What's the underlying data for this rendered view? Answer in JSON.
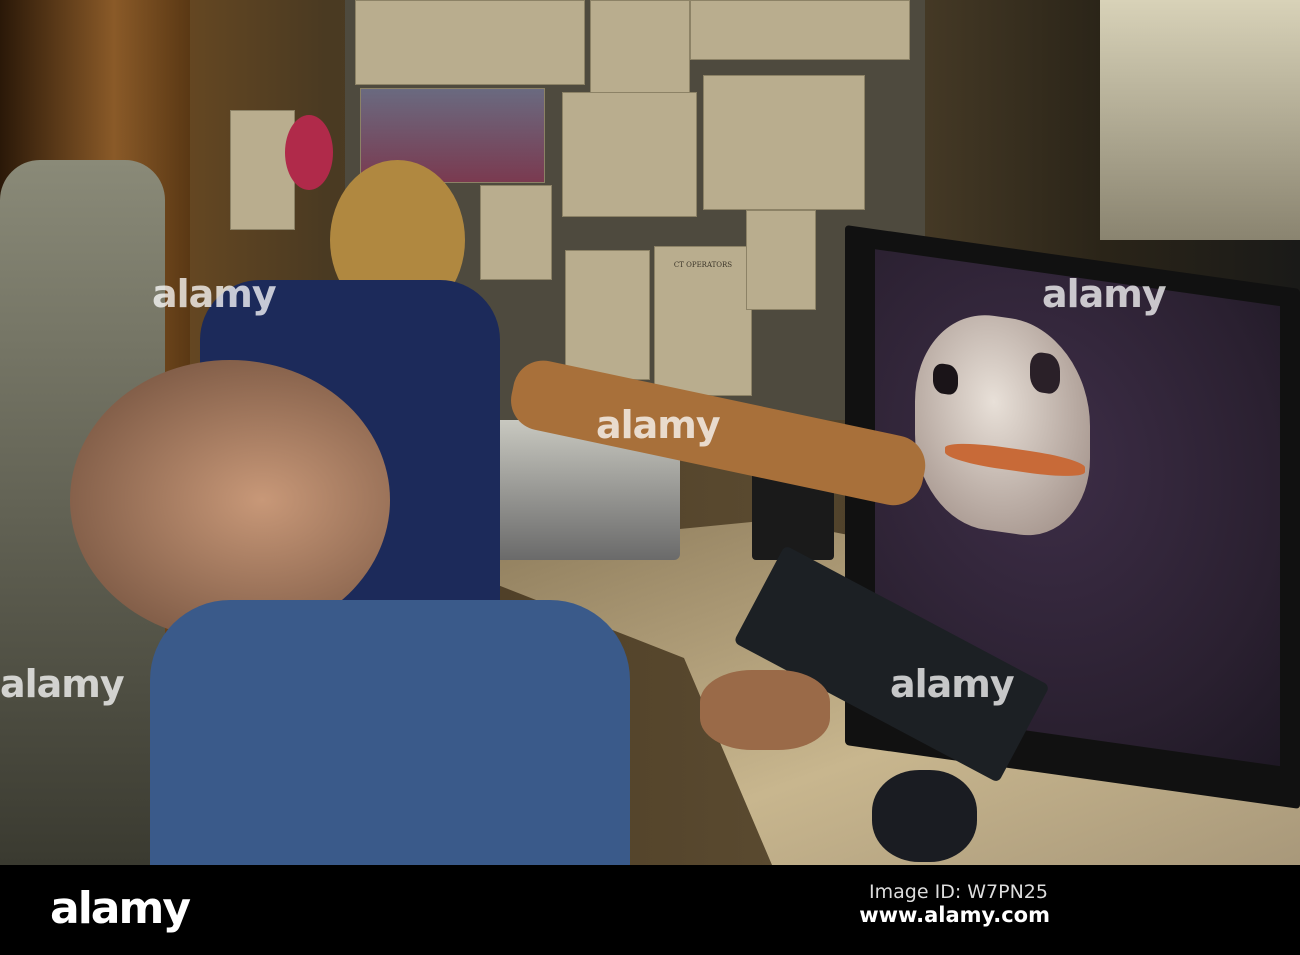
{
  "photo": {
    "notice_title": "CT OPERATORS",
    "watermarks": [
      "alamy",
      "alamy",
      "alamy",
      "alamy",
      "alamy",
      "alamy"
    ]
  },
  "footer": {
    "logo": "alamy",
    "image_id": "Image ID: W7PN25",
    "url": "www.alamy.com"
  }
}
